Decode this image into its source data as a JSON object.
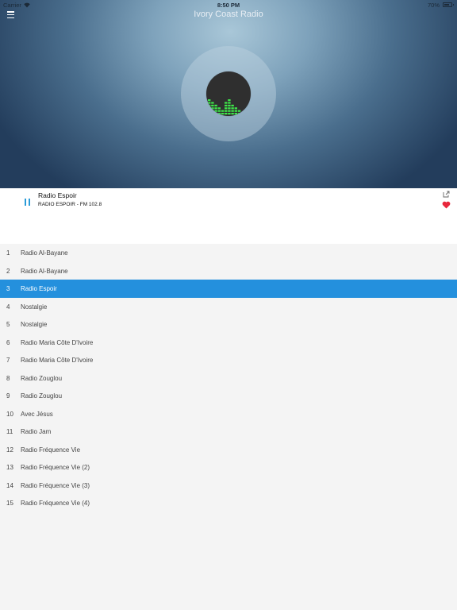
{
  "status_bar": {
    "carrier": "Carrier",
    "time": "8:50 PM",
    "battery": "70%"
  },
  "header": {
    "title": "Ivory Coast Radio"
  },
  "player": {
    "station_name": "Radio Espoir",
    "station_subtitle": "RADIO ESPOIR - FM 102.8",
    "accent_color": "#2a9bd8",
    "favorite_color": "#e8283c"
  },
  "list": {
    "selected_index": 3,
    "selected_color": "#2490dd",
    "items": [
      {
        "num": "1",
        "label": "Radio Al-Bayane"
      },
      {
        "num": "2",
        "label": "Radio Al-Bayane"
      },
      {
        "num": "3",
        "label": "Radio Espoir"
      },
      {
        "num": "4",
        "label": "Nostalgie"
      },
      {
        "num": "5",
        "label": "Nostalgie"
      },
      {
        "num": "6",
        "label": "Radio Maria Côte D'Ivoire"
      },
      {
        "num": "7",
        "label": "Radio Maria Côte D'Ivoire"
      },
      {
        "num": "8",
        "label": "Radio Zouglou"
      },
      {
        "num": "9",
        "label": "Radio Zouglou"
      },
      {
        "num": "10",
        "label": "Avec Jésus"
      },
      {
        "num": "11",
        "label": "Radio Jam"
      },
      {
        "num": "12",
        "label": "Radio Fréquence Vie"
      },
      {
        "num": "13",
        "label": "Radio Fréquence Vie (2)"
      },
      {
        "num": "14",
        "label": "Radio Fréquence Vie (3)"
      },
      {
        "num": "15",
        "label": "Radio Fréquence Vie (4)"
      }
    ]
  },
  "icons": {
    "menu": "hamburger-menu-icon",
    "play_state": "pause-icon",
    "share": "share-icon",
    "favorite": "heart-icon",
    "visualizer": "equalizer-icon"
  }
}
